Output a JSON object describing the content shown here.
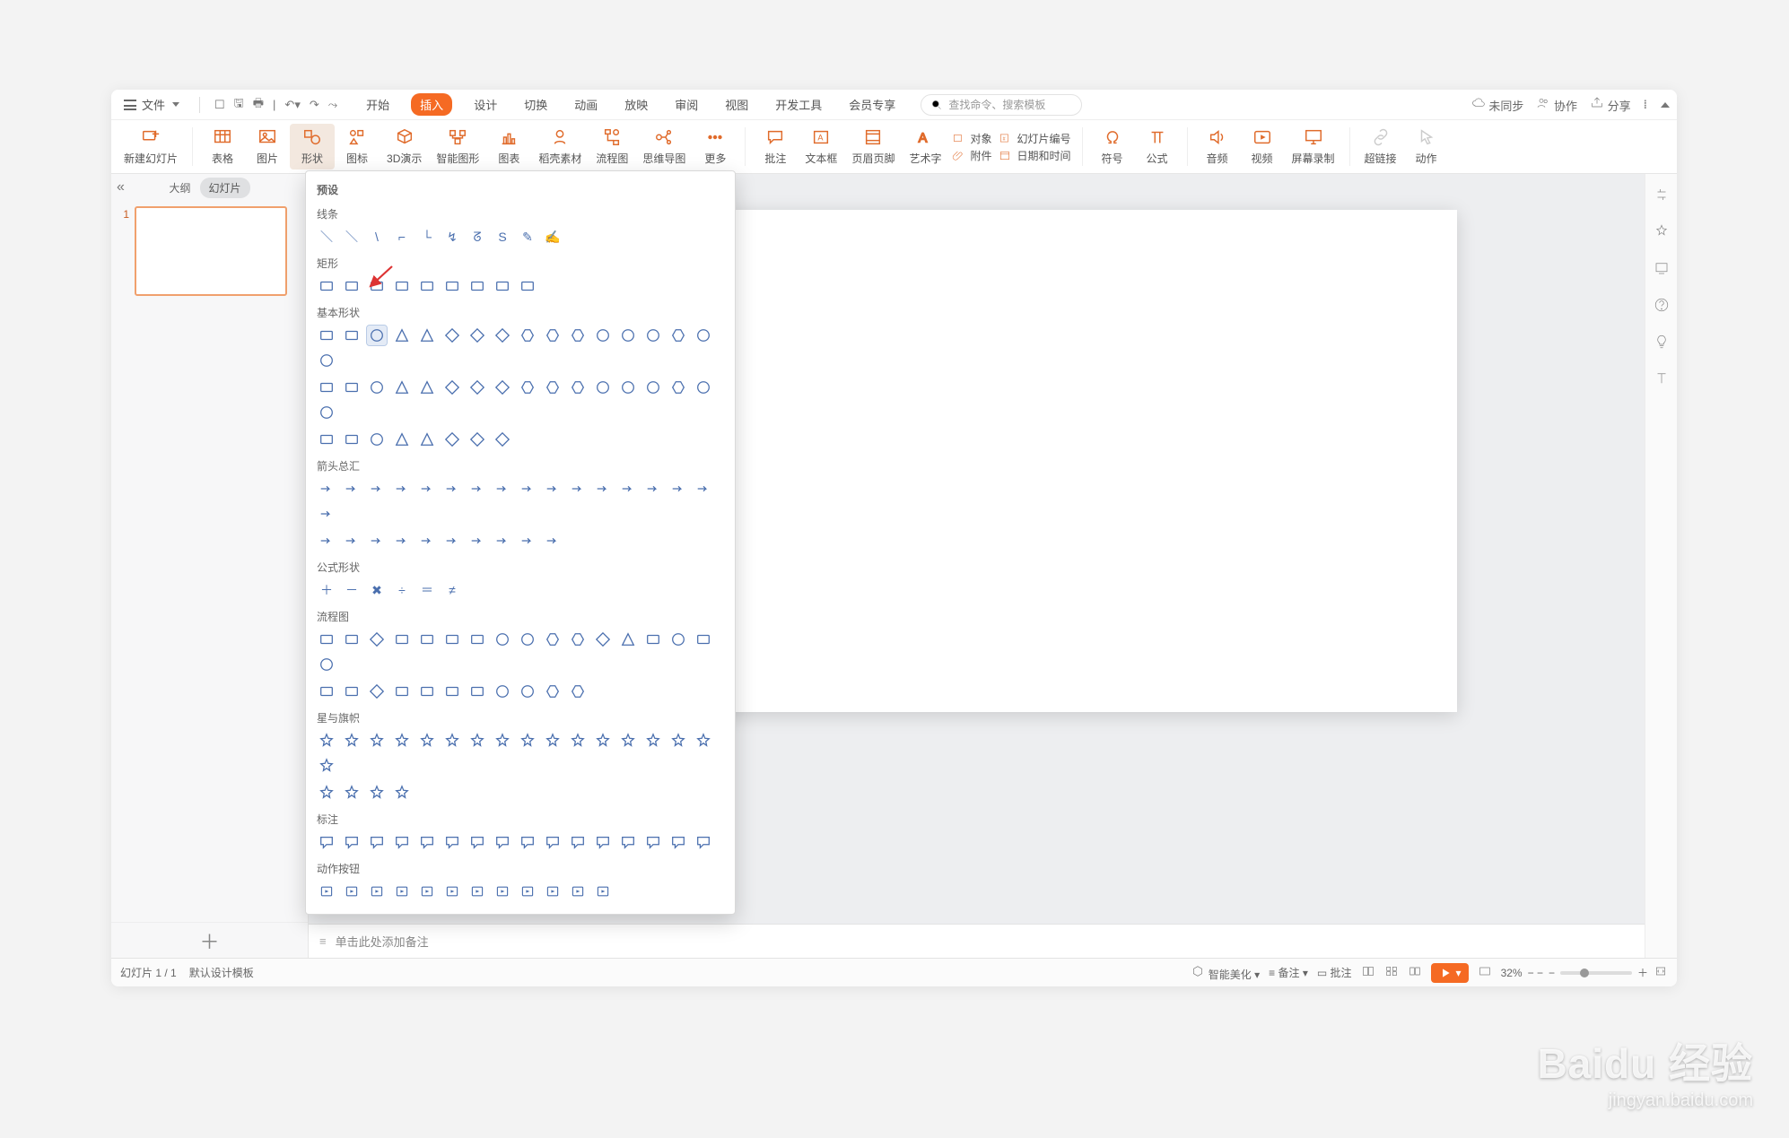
{
  "file_menu_label": "文件",
  "quick_access_icons": [
    "open-icon",
    "save-icon",
    "print-icon",
    "undo-icon",
    "redo-icon",
    "forward-icon"
  ],
  "tabs": [
    "开始",
    "插入",
    "设计",
    "切换",
    "动画",
    "放映",
    "审阅",
    "视图",
    "开发工具",
    "会员专享"
  ],
  "active_tab_index": 1,
  "search_placeholder": "查找命令、搜索模板",
  "top_right": {
    "unsynced": "未同步",
    "collab": "协作",
    "share": "分享"
  },
  "ribbon": {
    "new_slide": "新建幻灯片",
    "table": "表格",
    "picture": "图片",
    "shape": "形状",
    "icon": "图标",
    "threeD": "3D演示",
    "smartart": "智能图形",
    "chart": "图表",
    "docer": "稻壳素材",
    "flowchart": "流程图",
    "mindmap": "思维导图",
    "more": "更多",
    "comment": "批注",
    "textbox": "文本框",
    "headerfooter": "页眉页脚",
    "wordart": "艺术字",
    "object": "对象",
    "attachment": "附件",
    "slidenum": "幻灯片编号",
    "datetime": "日期和时间",
    "symbol": "符号",
    "equation": "公式",
    "audio": "音频",
    "video": "视频",
    "screenrec": "屏幕录制",
    "hyperlink": "超链接",
    "action": "动作"
  },
  "left_pane": {
    "outline": "大纲",
    "slides": "幻灯片",
    "slide_number": "1"
  },
  "shapes_dropdown": {
    "presets": "预设",
    "lines": "线条",
    "rects": "矩形",
    "basic": "基本形状",
    "arrows": "箭头总汇",
    "equation": "公式形状",
    "flowchart": "流程图",
    "stars": "星与旗帜",
    "callouts": "标注",
    "actionbuttons": "动作按钮",
    "line_glyphs": [
      "＼",
      "＼",
      "\\",
      "⌐",
      "└",
      "↯",
      "ᘔ",
      "S",
      "✎",
      "✍"
    ],
    "rect_count": 9,
    "basic_row_counts": [
      17,
      17,
      8
    ],
    "arrow_row_counts": [
      17,
      10
    ],
    "equation_glyphs": [
      "＋",
      "－",
      "✖",
      "÷",
      "＝",
      "≠"
    ],
    "flow_row_counts": [
      17,
      11
    ],
    "star_row_counts": [
      17,
      4
    ],
    "callout_count": 16,
    "action_count": 12,
    "selected_basic_index": 2
  },
  "notes_placeholder": "单击此处添加备注",
  "statusbar": {
    "page": "幻灯片 1 / 1",
    "template": "默认设计模板",
    "smart": "智能美化",
    "notes": "备注",
    "comments": "批注",
    "zoom": "32%",
    "dash": "− −"
  },
  "watermark": {
    "big": "Baidu 经验",
    "sub": "jingyan.baidu.com"
  }
}
